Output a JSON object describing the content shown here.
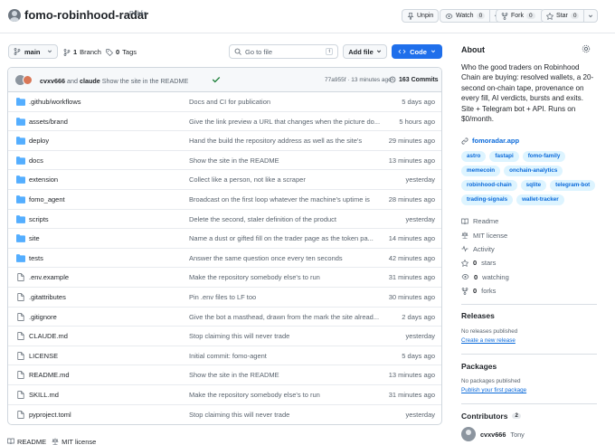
{
  "header": {
    "repo_name": "fomo-robinhood-radar",
    "visibility": "Public",
    "unpin_label": "Unpin",
    "watch_label": "Watch",
    "watch_count": "0",
    "fork_label": "Fork",
    "fork_count": "0",
    "star_label": "Star",
    "star_count": "0"
  },
  "toolbar": {
    "branch": "main",
    "branch_count": "1",
    "branch_label": "Branch",
    "tag_count": "0",
    "tag_label": "Tags",
    "goto_placeholder": "Go to file",
    "goto_shortcut": "t",
    "add_file_label": "Add file",
    "code_label": "Code"
  },
  "commit": {
    "author1": "cvxv666",
    "and": "and",
    "author2": "claude",
    "message": "Show the site in the README",
    "hash": "77a955f",
    "time": "13 minutes ago",
    "commits_count": "163 Commits"
  },
  "files": [
    {
      "type": "dir",
      "name": ".github/workflows",
      "message": "Docs and CI for publication",
      "time": "5 days ago"
    },
    {
      "type": "dir",
      "name": "assets/brand",
      "message": "Give the link preview a URL that changes when the picture do...",
      "time": "5 hours ago"
    },
    {
      "type": "dir",
      "name": "deploy",
      "message": "Hand the build the repository address as well as the site's",
      "time": "29 minutes ago"
    },
    {
      "type": "dir",
      "name": "docs",
      "message": "Show the site in the README",
      "time": "13 minutes ago"
    },
    {
      "type": "dir",
      "name": "extension",
      "message": "Collect like a person, not like a scraper",
      "time": "yesterday"
    },
    {
      "type": "dir",
      "name": "fomo_agent",
      "message": "Broadcast on the first loop whatever the machine's uptime is",
      "time": "28 minutes ago"
    },
    {
      "type": "dir",
      "name": "scripts",
      "message": "Delete the second, staler definition of the product",
      "time": "yesterday"
    },
    {
      "type": "dir",
      "name": "site",
      "message": "Name a dust or gifted fill on the trader page as the token pa...",
      "time": "14 minutes ago"
    },
    {
      "type": "dir",
      "name": "tests",
      "message": "Answer the same question once every ten seconds",
      "time": "42 minutes ago"
    },
    {
      "type": "file",
      "name": ".env.example",
      "message": "Make the repository somebody else's to run",
      "time": "31 minutes ago"
    },
    {
      "type": "file",
      "name": ".gitattributes",
      "message": "Pin .env files to LF too",
      "time": "30 minutes ago"
    },
    {
      "type": "file",
      "name": ".gitignore",
      "message": "Give the bot a masthead, drawn from the mark the site alread...",
      "time": "2 days ago"
    },
    {
      "type": "file",
      "name": "CLAUDE.md",
      "message": "Stop claiming this will never trade",
      "time": "yesterday"
    },
    {
      "type": "file",
      "name": "LICENSE",
      "message": "Initial commit: fomo-agent",
      "time": "5 days ago"
    },
    {
      "type": "file",
      "name": "README.md",
      "message": "Show the site in the README",
      "time": "13 minutes ago"
    },
    {
      "type": "file",
      "name": "SKILL.md",
      "message": "Make the repository somebody else's to run",
      "time": "31 minutes ago"
    },
    {
      "type": "file",
      "name": "pyproject.toml",
      "message": "Stop claiming this will never trade",
      "time": "yesterday"
    }
  ],
  "readme_tabs": {
    "readme": "README",
    "license": "MIT license"
  },
  "about": {
    "heading": "About",
    "description": "Who the good traders on Robinhood Chain are buying: resolved wallets, a 20-second on-chain tape, provenance on every fill, AI verdicts, bursts and exits. Site + Telegram bot + API. Runs on $0/month.",
    "website": "fomoradar.app",
    "topics": [
      "astro",
      "fastapi",
      "fomo-family",
      "memecoin",
      "onchain-analytics",
      "robinhood-chain",
      "sqlite",
      "telegram-bot",
      "trading-signals",
      "wallet-tracker"
    ],
    "readme": "Readme",
    "license": "MIT license",
    "activity": "Activity",
    "stars": "0",
    "stars_label": "stars",
    "watching": "0",
    "watching_label": "watching",
    "forks": "0",
    "forks_label": "forks"
  },
  "releases": {
    "heading": "Releases",
    "empty": "No releases published",
    "link": "Create a new release"
  },
  "packages": {
    "heading": "Packages",
    "empty": "No packages published",
    "link": "Publish your first package"
  },
  "contributors": {
    "heading": "Contributors",
    "count": "2",
    "first_name": "cvxv666",
    "first_sub": "Tony"
  },
  "colors": {
    "accent": "#1f6feb",
    "link": "#0969da",
    "folder": "#54aeff",
    "success": "#1a7f37"
  }
}
